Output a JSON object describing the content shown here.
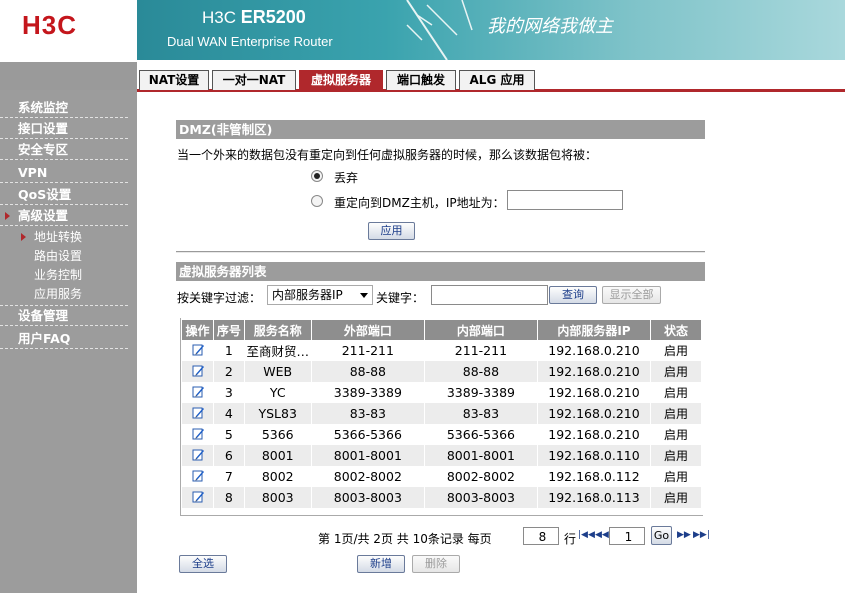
{
  "header": {
    "logo": "H3C",
    "product_prefix": "H3C",
    "product_model": "ER5200",
    "subtitle": "Dual WAN Enterprise Router",
    "slogan": "我的网络我做主"
  },
  "sidebar": {
    "items": [
      {
        "label": "系统监控"
      },
      {
        "label": "接口设置"
      },
      {
        "label": "安全专区"
      },
      {
        "label": "VPN"
      },
      {
        "label": "QoS设置"
      },
      {
        "label": "高级设置"
      },
      {
        "label": "设备管理"
      },
      {
        "label": "用户FAQ"
      }
    ],
    "subitems": [
      {
        "label": "地址转换"
      },
      {
        "label": "路由设置"
      },
      {
        "label": "业务控制"
      },
      {
        "label": "应用服务"
      }
    ]
  },
  "tabs": [
    {
      "label": "NAT设置"
    },
    {
      "label": "一对一NAT"
    },
    {
      "label": "虚拟服务器"
    },
    {
      "label": "端口触发"
    },
    {
      "label": "ALG 应用"
    }
  ],
  "dmz": {
    "title": "DMZ(非管制区)",
    "description": "当一个外来的数据包没有重定向到任何虚拟服务器的时候，那么该数据包将被：",
    "option_discard": "丢弃",
    "option_redirect": "重定向到DMZ主机，IP地址为：",
    "ip_value": "",
    "apply_label": "应用"
  },
  "vserver": {
    "title": "虚拟服务器列表",
    "filter_label": "按关键字过滤：",
    "filter_select": "内部服务器IP",
    "keyword_label": "关键字：",
    "keyword_value": "",
    "query_label": "查询",
    "show_all_label": "显示全部",
    "columns": [
      "操作",
      "序号",
      "服务名称",
      "外部端口",
      "内部端口",
      "内部服务器IP",
      "状态"
    ],
    "rows": [
      {
        "idx": "1",
        "name": "至商财贸…",
        "ext": "211-211",
        "int": "211-211",
        "ip": "192.168.0.210",
        "status": "启用"
      },
      {
        "idx": "2",
        "name": "WEB",
        "ext": "88-88",
        "int": "88-88",
        "ip": "192.168.0.210",
        "status": "启用"
      },
      {
        "idx": "3",
        "name": "YC",
        "ext": "3389-3389",
        "int": "3389-3389",
        "ip": "192.168.0.210",
        "status": "启用"
      },
      {
        "idx": "4",
        "name": "YSL83",
        "ext": "83-83",
        "int": "83-83",
        "ip": "192.168.0.210",
        "status": "启用"
      },
      {
        "idx": "5",
        "name": "5366",
        "ext": "5366-5366",
        "int": "5366-5366",
        "ip": "192.168.0.210",
        "status": "启用"
      },
      {
        "idx": "6",
        "name": "8001",
        "ext": "8001-8001",
        "int": "8001-8001",
        "ip": "192.168.0.110",
        "status": "启用"
      },
      {
        "idx": "7",
        "name": "8002",
        "ext": "8002-8002",
        "int": "8002-8002",
        "ip": "192.168.0.112",
        "status": "启用"
      },
      {
        "idx": "8",
        "name": "8003",
        "ext": "8003-8003",
        "int": "8003-8003",
        "ip": "192.168.0.113",
        "status": "启用"
      }
    ],
    "pagination": {
      "page_info": "第 1页/共 2页 共 10条记录 每页",
      "per_page": "8",
      "row_label": "行",
      "goto_page": "1",
      "go_label": "Go"
    },
    "select_all_label": "全选",
    "add_label": "新增",
    "delete_label": "删除"
  },
  "colors": {
    "accent": "#b0282c",
    "sidebar_bg": "#9c9c9c",
    "banner": "#3aa3ae"
  }
}
